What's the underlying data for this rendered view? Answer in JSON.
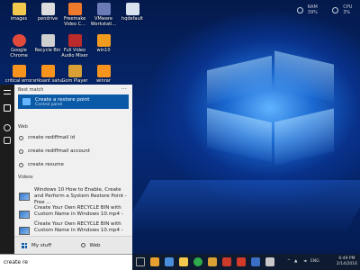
{
  "desktop": {
    "icons": [
      {
        "label": "images",
        "color": "#f2c94c"
      },
      {
        "label": "pendrive",
        "color": "#ddd"
      },
      {
        "label": "Freemake Video C...",
        "color": "#f07a2c"
      },
      {
        "label": "VMware Workstati...",
        "color": "#6a7bb6"
      },
      {
        "label": "hqdefault",
        "color": "#d9e2ef"
      },
      {
        "label": "Google Chrome",
        "color": "#e24a3b"
      },
      {
        "label": "Recycle Bin",
        "color": "#d0d0d0"
      },
      {
        "label": "Full Video Audio Mixer",
        "color": "#bc2b2b"
      },
      {
        "label": "win10",
        "color": "#f29c1f"
      },
      {
        "label": "critical error",
        "color": "#f7941d"
      },
      {
        "label": "sriksant sahu",
        "color": "#f7941d"
      },
      {
        "label": "Gom Player",
        "color": "#d9a035"
      },
      {
        "label": "winrar",
        "color": "#f7941d"
      }
    ]
  },
  "monitor": {
    "ram": "RAM 39%",
    "cpu": "CPU 3%"
  },
  "search": {
    "best_match_header": "Best match",
    "best": {
      "title": "Create a restore point",
      "subtitle": "Control panel"
    },
    "web_header": "Web",
    "web": [
      "create rediffmail id",
      "create rediffmail account",
      "create resume"
    ],
    "videos_header": "Videos",
    "videos": [
      {
        "title": "Windows 10 How to Enable, Create and Perform a System Restore Point - Free ..."
      },
      {
        "title": "Create Your Own RECYCLE BIN with Custom Name in Windows 10.mp4 - ..."
      },
      {
        "title": "Create Your Own RECYCLE BIN with Custom Name in Windows 10.mp4 - ..."
      }
    ],
    "my_stuff": "My stuff",
    "web_button": "Web",
    "query": "create re"
  },
  "taskbar": {
    "lang": "ENG",
    "time": "6:49 PM",
    "date": "2/14/2016"
  },
  "colors": {
    "accent": "#0a5aa7",
    "taskbar": "#0d1a2f"
  }
}
